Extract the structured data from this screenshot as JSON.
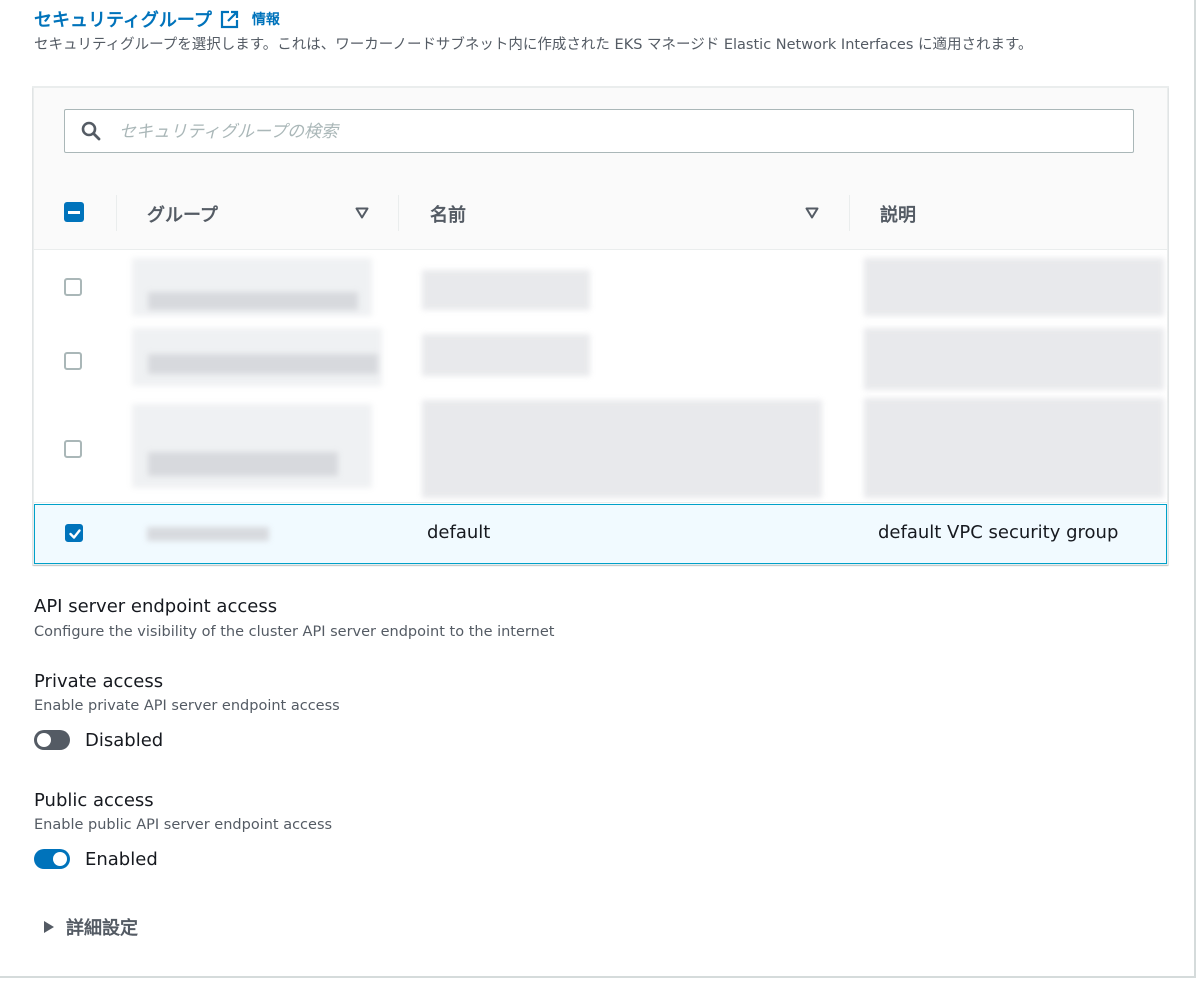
{
  "security_group": {
    "title": "セキュリティグループ",
    "info_link": "情報",
    "description": "セキュリティグループを選択します。これは、ワーカーノードサブネット内に作成された EKS マネージド Elastic Network Interfaces に適用されます。",
    "search_placeholder": "セキュリティグループの検索",
    "columns": [
      "グループ",
      "名前",
      "説明"
    ],
    "rows": [
      {
        "group": "",
        "name": "",
        "description": "",
        "checked": false
      },
      {
        "group": "",
        "name": "",
        "description": "",
        "checked": false
      },
      {
        "group": "",
        "name": "",
        "description": "",
        "checked": false
      },
      {
        "group": "",
        "name": "default",
        "description": "default VPC security group",
        "checked": true
      }
    ]
  },
  "endpoint_access": {
    "title": "API server endpoint access",
    "description": "Configure the visibility of the cluster API server endpoint to the internet",
    "private": {
      "title": "Private access",
      "description": "Enable private API server endpoint access",
      "state_label": "Disabled",
      "enabled": false
    },
    "public": {
      "title": "Public access",
      "description": "Enable public API server endpoint access",
      "state_label": "Enabled",
      "enabled": true
    }
  },
  "advanced": {
    "label": "詳細設定"
  },
  "colors": {
    "link": "#0073bb",
    "toggle_on": "#0073bb",
    "toggle_off": "#545b64",
    "selected_row_bg": "#f1faff",
    "selected_row_border": "#00a1c9"
  }
}
